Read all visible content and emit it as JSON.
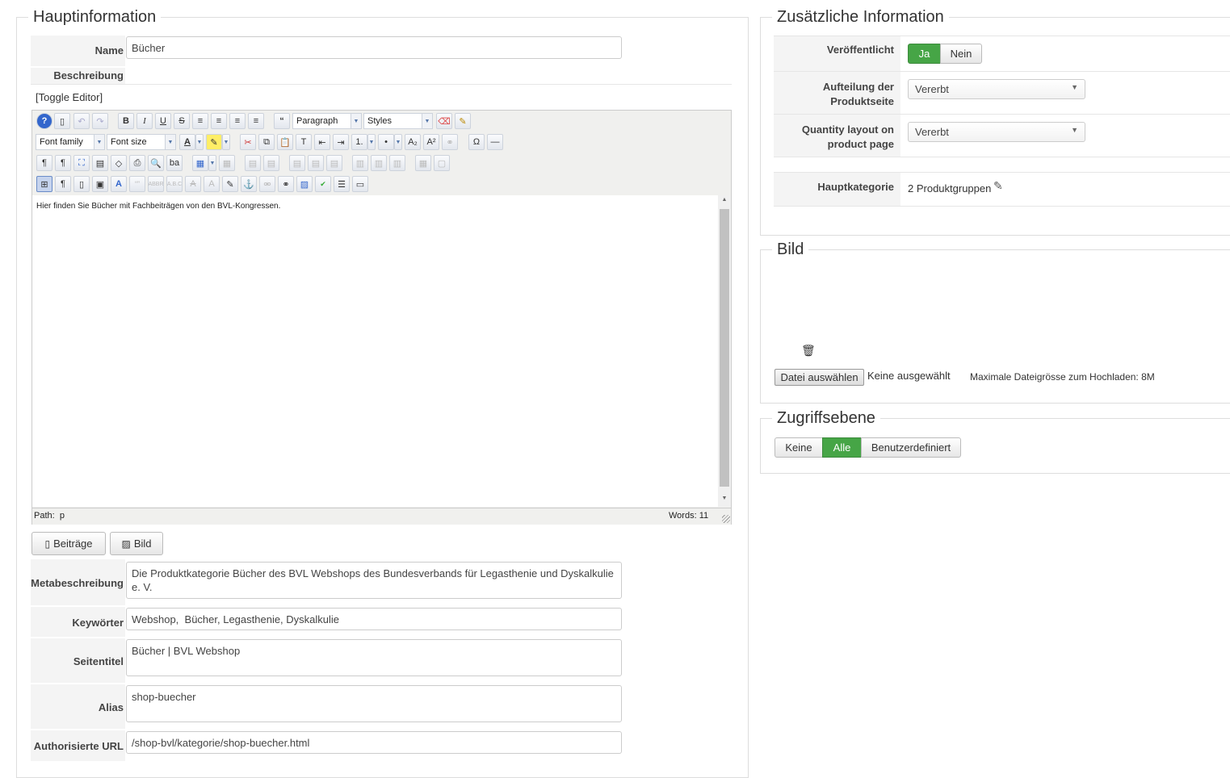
{
  "main": {
    "legend": "Hauptinformation",
    "name_label": "Name",
    "name_value": "Bücher",
    "beschreibung_label": "Beschreibung",
    "toggle_editor": "[Toggle Editor]",
    "editor": {
      "paragraph": "Paragraph",
      "styles": "Styles",
      "font_family": "Font family",
      "font_size": "Font size",
      "content": "Hier finden Sie Bücher mit Fachbeiträgen von den BVL-Kongressen.",
      "path_label": "Path:",
      "path_value": "p",
      "words": "Words: 11"
    },
    "beitraege_button": "Beiträge",
    "bild_button": "Bild",
    "meta_label": "Metabeschreibung",
    "meta_value": "Die Produktkategorie Bücher des BVL Webshops des Bundesverbands für Legasthenie und Dyskalkulie e. V.",
    "keywords_label": "Keywörter",
    "keywords_value": "Webshop,  Bücher, Legasthenie, Dyskalkulie",
    "title_label": "Seitentitel",
    "title_value": "Bücher | BVL Webshop",
    "alias_label": "Alias",
    "alias_value": "shop-buecher",
    "url_label": "Authorisierte URL",
    "url_value": "/shop-bvl/kategorie/shop-buecher.html"
  },
  "extra": {
    "legend": "Zusätzliche Information",
    "published_label": "Veröffentlicht",
    "yes": "Ja",
    "no": "Nein",
    "split_label_1": "Aufteilung der",
    "split_label_2": "Produktseite",
    "split_value": "Vererbt",
    "qty_label_1": "Quantity layout on",
    "qty_label_2": "product page",
    "qty_value": "Vererbt",
    "maincat_label": "Hauptkategorie",
    "maincat_value": "2 Produktgruppen"
  },
  "image": {
    "legend": "Bild",
    "file_button": "Datei auswählen",
    "file_status": "Keine ausgewählt",
    "max_size": "Maximale Dateigrösse zum Hochladen: 8M"
  },
  "access": {
    "legend": "Zugriffsebene",
    "options": [
      "Keine",
      "Alle",
      "Benutzerdefiniert"
    ]
  },
  "colors": {
    "green": "#46a546"
  }
}
